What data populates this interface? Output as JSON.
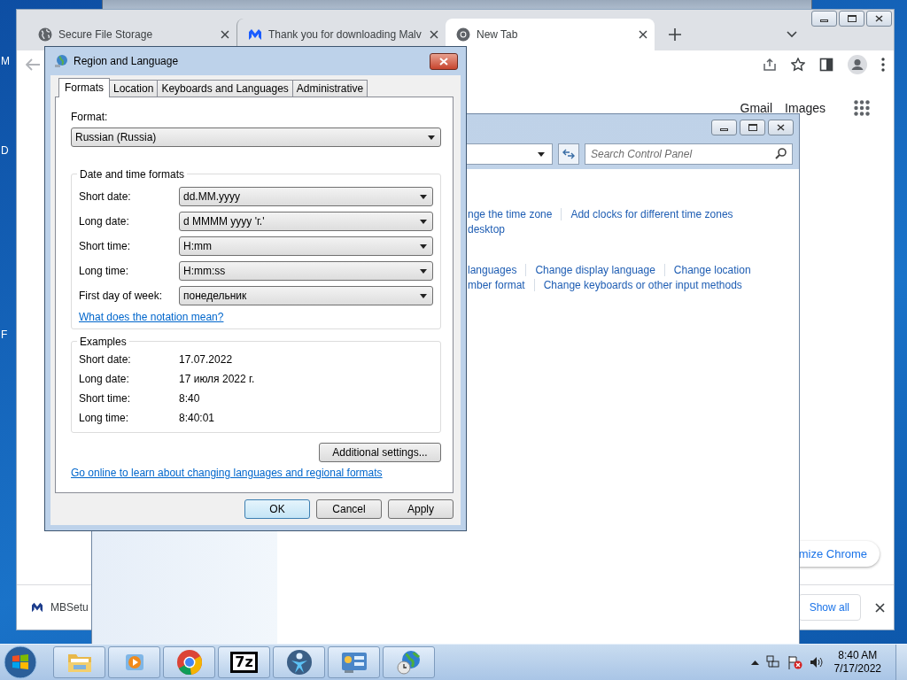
{
  "desktop": {
    "icon_labels": [
      "M",
      "D",
      "F"
    ]
  },
  "browser": {
    "tabs": [
      {
        "title": "Secure File Storage",
        "kind": "globe",
        "selected": false
      },
      {
        "title": "Thank you for downloading Malv",
        "kind": "malwarebytes",
        "selected": false
      },
      {
        "title": "New Tab",
        "kind": "chrome",
        "selected": true
      }
    ],
    "links": [
      "Gmail",
      "Images"
    ],
    "customize_button": "mize Chrome",
    "downloads": {
      "items": [
        {
          "name": "MBSetu"
        }
      ],
      "show_all": "Show all"
    }
  },
  "control_panel": {
    "search": {
      "placeholder": "Search Control Panel"
    },
    "link_rows": [
      [
        "nge the time zone",
        "Add clocks for different time zones"
      ],
      [
        "desktop"
      ],
      [
        "languages",
        "Change display language",
        "Change location"
      ],
      [
        "mber format",
        "Change keyboards or other input methods"
      ]
    ]
  },
  "dialog": {
    "title": "Region and Language",
    "tabs": [
      {
        "label": "Formats",
        "selected": true
      },
      {
        "label": "Location",
        "selected": false
      },
      {
        "label": "Keyboards and Languages",
        "selected": false
      },
      {
        "label": "Administrative",
        "selected": false
      }
    ],
    "format_label": "Format:",
    "format_value": "Russian (Russia)",
    "datetime_group": "Date and time formats",
    "datetime_rows": [
      {
        "label": "Short date:",
        "value": "dd.MM.yyyy"
      },
      {
        "label": "Long date:",
        "value": "d MMMM yyyy 'г.'"
      },
      {
        "label": "Short time:",
        "value": "H:mm"
      },
      {
        "label": "Long time:",
        "value": "H:mm:ss"
      },
      {
        "label": "First day of week:",
        "value": "понедельник"
      }
    ],
    "notation_link": "What does the notation mean?",
    "examples_group": "Examples",
    "examples": [
      {
        "label": "Short date:",
        "value": "17.07.2022"
      },
      {
        "label": "Long date:",
        "value": "17 июля 2022 г."
      },
      {
        "label": "Short time:",
        "value": "8:40"
      },
      {
        "label": "Long time:",
        "value": "8:40:01"
      }
    ],
    "additional_button": "Additional settings...",
    "online_link": "Go online to learn about changing languages and regional formats",
    "buttons": [
      {
        "label": "OK",
        "default": true
      },
      {
        "label": "Cancel",
        "default": false
      },
      {
        "label": "Apply",
        "default": false
      }
    ]
  },
  "taskbar": {
    "apps": [
      {
        "kind": "folder"
      },
      {
        "kind": "media"
      },
      {
        "kind": "chrome"
      },
      {
        "kind": "sevenzip",
        "label": "7z"
      },
      {
        "kind": "figure"
      },
      {
        "kind": "control-panel"
      },
      {
        "kind": "globe-clock"
      }
    ],
    "time": "8:40 AM",
    "date": "7/17/2022"
  }
}
